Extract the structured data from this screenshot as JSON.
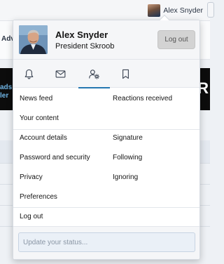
{
  "topbar": {
    "username": "Alex Snyder"
  },
  "background": {
    "nav_fragment": "Adv",
    "banner_left_fragment_1": "ads",
    "banner_left_fragment_2": "ler",
    "banner_right_fragment": "R"
  },
  "user": {
    "name": "Alex Snyder",
    "title": "President Skroob"
  },
  "header": {
    "logout_label": "Log out"
  },
  "tabs": [
    {
      "icon": "bell-icon",
      "active": false
    },
    {
      "icon": "envelope-icon",
      "active": false
    },
    {
      "icon": "user-cog-icon",
      "active": true
    },
    {
      "icon": "bookmark-icon",
      "active": false
    }
  ],
  "links": {
    "news_feed": "News feed",
    "reactions_received": "Reactions received",
    "your_content": "Your content",
    "account_details": "Account details",
    "signature": "Signature",
    "password_security": "Password and security",
    "following": "Following",
    "privacy": "Privacy",
    "ignoring": "Ignoring",
    "preferences": "Preferences",
    "log_out": "Log out"
  },
  "status": {
    "placeholder": "Update your status..."
  },
  "colors": {
    "accent": "#2577b1",
    "header_bg": "#f5f6f8",
    "button_bg": "#d3d3d3"
  }
}
